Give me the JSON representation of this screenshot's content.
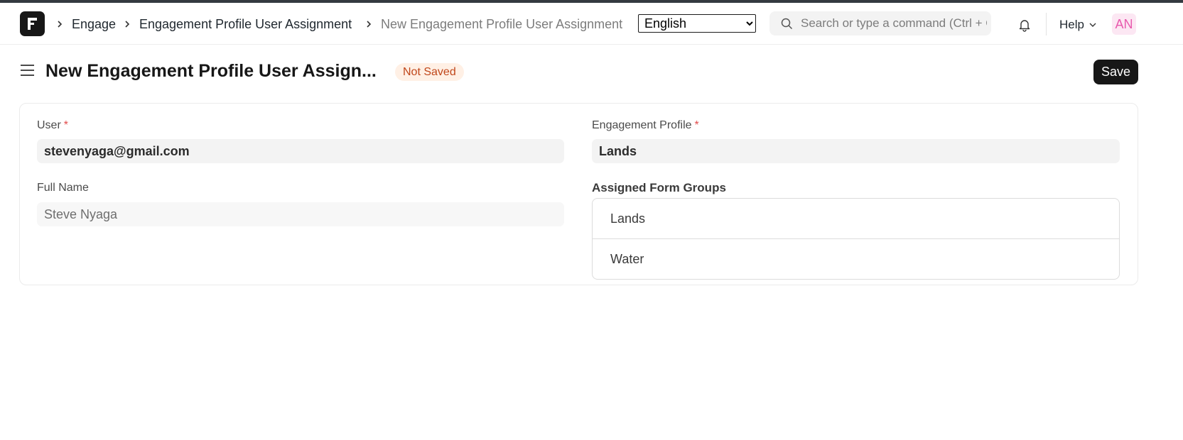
{
  "navbar": {
    "logo_letter": "F",
    "breadcrumbs": [
      {
        "label": "Engage"
      },
      {
        "label": "Engagement Profile User Assignment"
      },
      {
        "label": "New Engagement Profile User Assignment"
      }
    ],
    "language": {
      "selected": "English"
    },
    "search": {
      "placeholder": "Search or type a command (Ctrl + G)"
    },
    "help_label": "Help",
    "avatar_initials": "AN"
  },
  "page": {
    "title": "New Engagement Profile User Assign...",
    "status_badge": "Not Saved",
    "save_label": "Save"
  },
  "form": {
    "user": {
      "label": "User",
      "required_mark": "*",
      "value": "stevenyaga@gmail.com"
    },
    "full_name": {
      "label": "Full Name",
      "value": "Steve Nyaga"
    },
    "engagement_profile": {
      "label": "Engagement Profile",
      "required_mark": "*",
      "value": "Lands"
    },
    "assigned_form_groups": {
      "label": "Assigned Form Groups",
      "items": [
        "Lands",
        "Water"
      ]
    }
  },
  "colors": {
    "accent": "#171717",
    "badge_bg": "#fff0e5",
    "badge_text": "#c0471b",
    "avatar_bg": "#fce7f3",
    "avatar_text": "#e85aad",
    "required": "#e24c4c"
  }
}
